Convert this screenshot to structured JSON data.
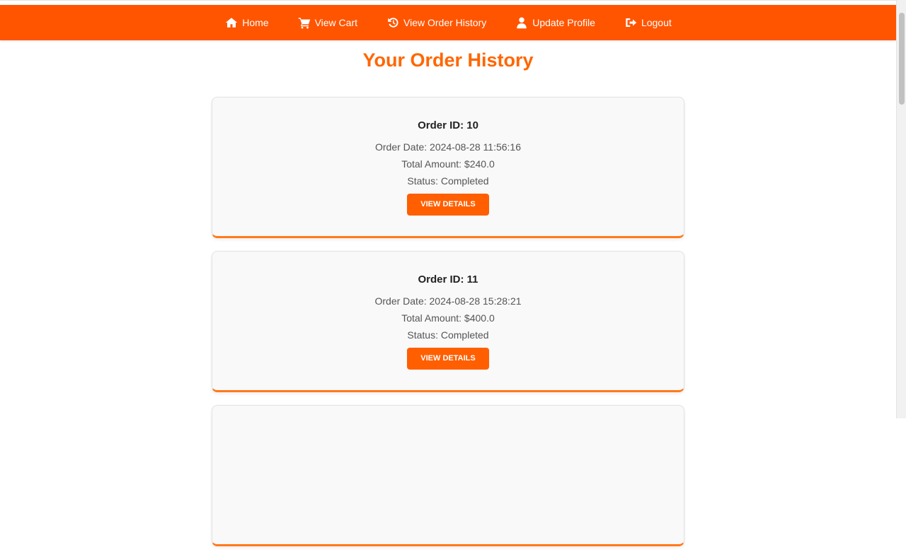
{
  "nav": {
    "items": [
      {
        "label": "Home",
        "icon": "home-icon"
      },
      {
        "label": "View Cart",
        "icon": "cart-icon"
      },
      {
        "label": "View Order History",
        "icon": "history-icon"
      },
      {
        "label": "Update Profile",
        "icon": "user-icon"
      },
      {
        "label": "Logout",
        "icon": "logout-icon"
      }
    ]
  },
  "page": {
    "title": "Your Order History"
  },
  "orders": [
    {
      "id": "Order ID: 10",
      "date": "Order Date: 2024-08-28 11:56:16",
      "amount": "Total Amount: $240.0",
      "status": "Status: Completed",
      "button": "View Details"
    },
    {
      "id": "Order ID: 11",
      "date": "Order Date: 2024-08-28 15:28:21",
      "amount": "Total Amount: $400.0",
      "status": "Status: Completed",
      "button": "View Details"
    }
  ],
  "colors": {
    "brand": "#ff5500",
    "title": "#ff6600",
    "card_border_accent": "#ff7a1a"
  }
}
